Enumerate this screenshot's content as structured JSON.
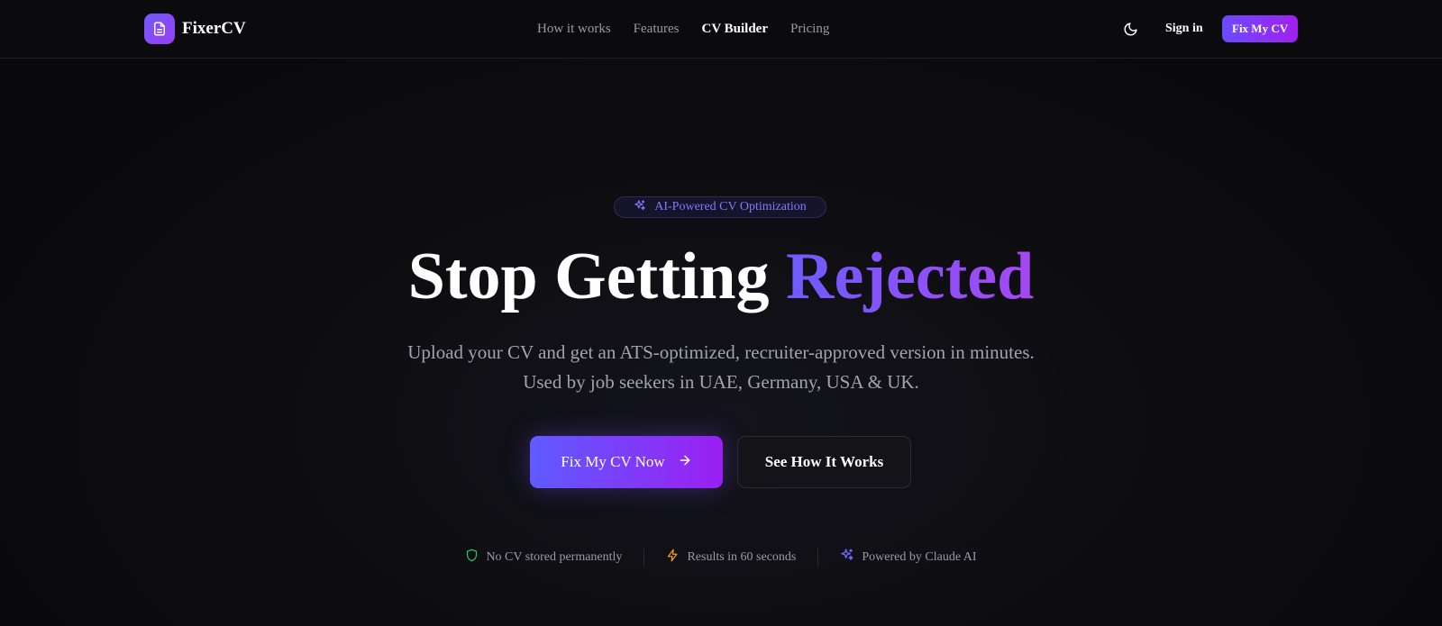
{
  "header": {
    "brand": {
      "name": "FixerCV",
      "icon": "document-icon"
    },
    "nav": [
      {
        "label": "How it works",
        "active": false
      },
      {
        "label": "Features",
        "active": false
      },
      {
        "label": "CV Builder",
        "active": true
      },
      {
        "label": "Pricing",
        "active": false
      }
    ],
    "theme_toggle_icon": "moon-icon",
    "sign_in_label": "Sign in",
    "cta_label": "Fix My CV"
  },
  "hero": {
    "badge": {
      "icon": "sparkles-icon",
      "text": "AI-Powered CV Optimization"
    },
    "title_main": "Stop Getting",
    "title_accent": "Rejected",
    "subtitle_line1": "Upload your CV and get an ATS-optimized, recruiter-approved version in minutes.",
    "subtitle_line2": "Used by job seekers in UAE, Germany, USA & UK.",
    "primary_button": {
      "label": "Fix My CV Now",
      "icon": "arrow-right-icon"
    },
    "secondary_button": {
      "label": "See How It Works"
    }
  },
  "features": [
    {
      "icon": "shield-icon",
      "text": "No CV stored permanently",
      "color": "#22c55e"
    },
    {
      "icon": "lightning-icon",
      "text": "Results in 60 seconds",
      "color": "#f59e0b"
    },
    {
      "icon": "sparkles-icon",
      "text": "Powered by Claude AI",
      "color": "#6d6bff"
    }
  ],
  "colors": {
    "background": "#0a0a0c",
    "accent_start": "#6d5cff",
    "accent_end": "#a020f0",
    "badge_text": "#7f7bff"
  }
}
